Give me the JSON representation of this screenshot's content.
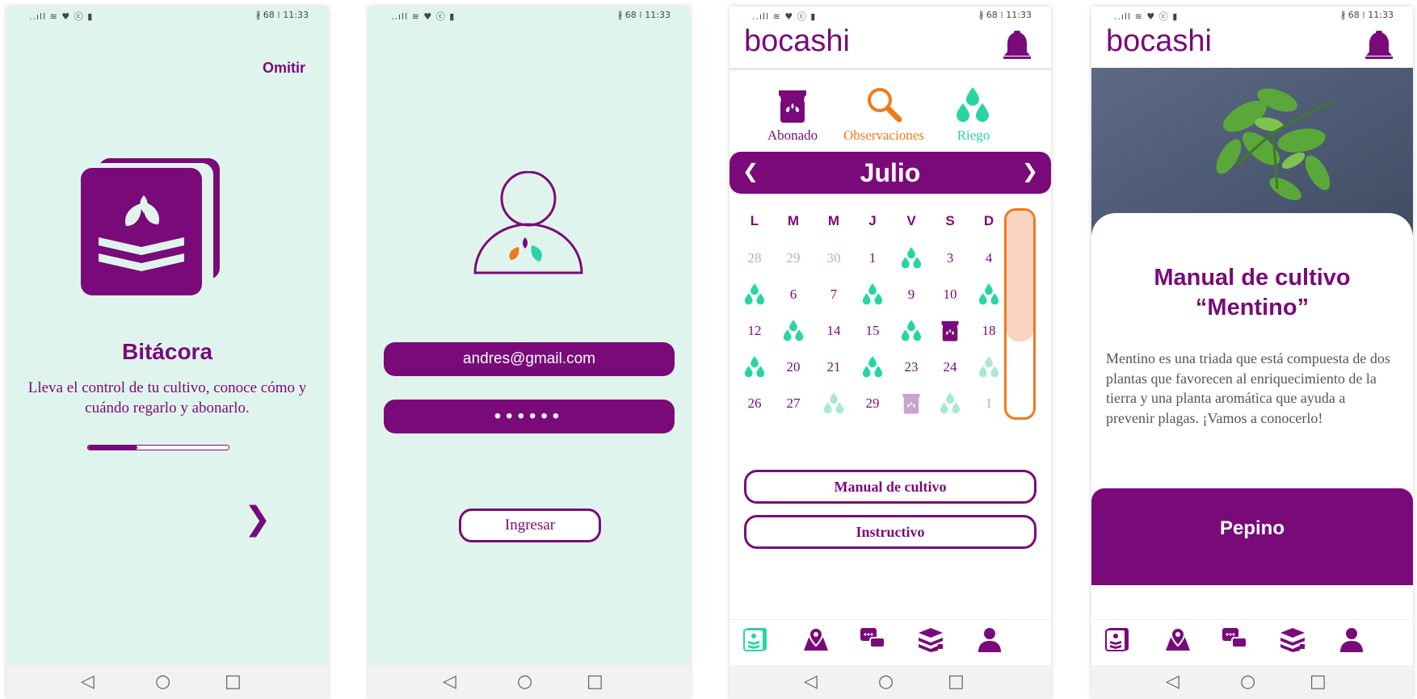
{
  "status": {
    "left": "..ıll ≋ ♥ ⓒ ▮",
    "right": "∦ 68 ⁞ 11:33"
  },
  "screen1": {
    "skip": "Omitir",
    "title": "Bitácora",
    "description": "Lleva el control de tu cultivo, conoce cómo y cuándo regarlo y abonarlo.",
    "progress": 0.35,
    "next": "❯"
  },
  "screen2": {
    "email": "andres@gmail.com",
    "password": "••••••",
    "login": "Ingresar"
  },
  "screen3": {
    "app_title": "bocashi",
    "legend": [
      {
        "label": "Abonado",
        "color": "#7a0a7a",
        "icon": "bag-icon"
      },
      {
        "label": "Observaciones",
        "color": "#f07a1a",
        "icon": "magnifier-icon"
      },
      {
        "label": "Riego",
        "color": "#25d6a4",
        "icon": "drops-icon"
      }
    ],
    "month": "Julio",
    "prev": "❮",
    "next": "❯",
    "weekdays": [
      "L",
      "M",
      "M",
      "J",
      "V",
      "S",
      "D"
    ],
    "weeks": [
      [
        {
          "t": "28",
          "k": "muted"
        },
        {
          "t": "29",
          "k": "muted"
        },
        {
          "t": "30",
          "k": "muted"
        },
        {
          "t": "1",
          "k": "n"
        },
        {
          "t": "",
          "k": "drop"
        },
        {
          "t": "3",
          "k": "n"
        },
        {
          "t": "4",
          "k": "n"
        }
      ],
      [
        {
          "t": "",
          "k": "drop"
        },
        {
          "t": "6",
          "k": "n"
        },
        {
          "t": "7",
          "k": "n"
        },
        {
          "t": "",
          "k": "drop"
        },
        {
          "t": "9",
          "k": "n"
        },
        {
          "t": "10",
          "k": "n"
        },
        {
          "t": "",
          "k": "drop"
        }
      ],
      [
        {
          "t": "12",
          "k": "n"
        },
        {
          "t": "",
          "k": "drop"
        },
        {
          "t": "14",
          "k": "n"
        },
        {
          "t": "15",
          "k": "n"
        },
        {
          "t": "",
          "k": "drop"
        },
        {
          "t": "",
          "k": "bag"
        },
        {
          "t": "18",
          "k": "n"
        }
      ],
      [
        {
          "t": "",
          "k": "drop"
        },
        {
          "t": "20",
          "k": "n"
        },
        {
          "t": "21",
          "k": "n"
        },
        {
          "t": "",
          "k": "drop"
        },
        {
          "t": "23",
          "k": "n"
        },
        {
          "t": "24",
          "k": "n"
        },
        {
          "t": "",
          "k": "droplight"
        }
      ],
      [
        {
          "t": "26",
          "k": "n"
        },
        {
          "t": "27",
          "k": "n"
        },
        {
          "t": "",
          "k": "droplight"
        },
        {
          "t": "29",
          "k": "n"
        },
        {
          "t": "",
          "k": "baglight"
        },
        {
          "t": "",
          "k": "droplight"
        },
        {
          "t": "1",
          "k": "muted"
        }
      ]
    ],
    "btn_manual": "Manual de cultivo",
    "btn_instructivo": "Instructivo"
  },
  "screen4": {
    "app_title": "bocashi",
    "heading": "Manual de cultivo “Mentino”",
    "body": "Mentino es una triada que está compuesta de dos plantas que favorecen al enriquecimiento de la tierra y una planta aromática que ayuda a prevenir plagas. ¡Vamos a conocerlo!",
    "card": "Pepino"
  },
  "tabs": [
    "book-icon",
    "map-icon",
    "chat-icon",
    "layers-icon",
    "user-icon"
  ],
  "navkeys": [
    "◁",
    "○",
    "□"
  ],
  "colors": {
    "purple": "#7a0a7a",
    "mint": "#e0f4ee",
    "orange": "#f07a1a",
    "green": "#25d6a4"
  }
}
